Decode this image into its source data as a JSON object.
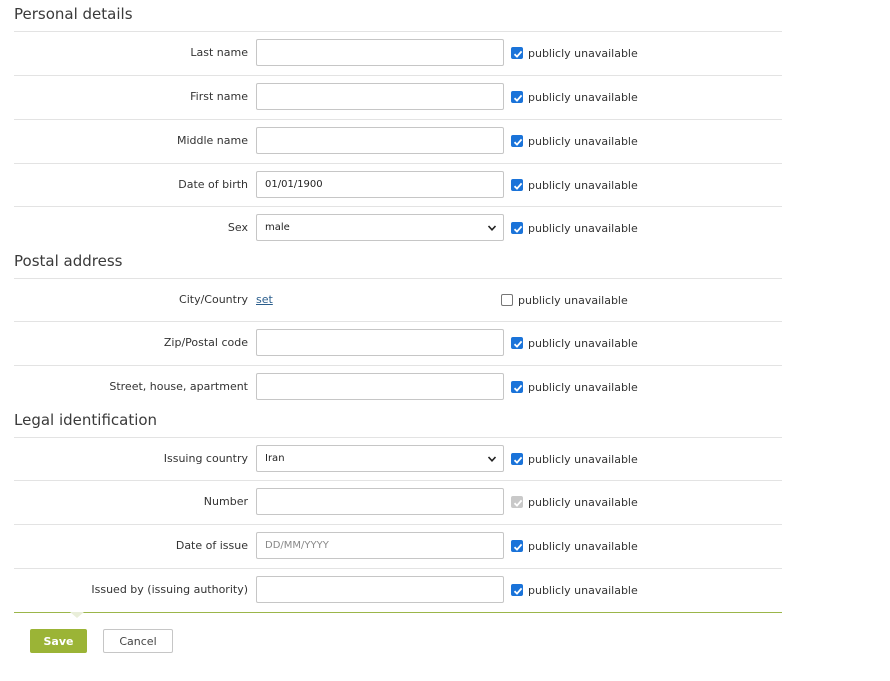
{
  "sections": {
    "personal": "Personal details",
    "postal": "Postal address",
    "legal": "Legal identification"
  },
  "checkbox_label": "publicly unavailable",
  "fields": {
    "last_name": {
      "label": "Last name",
      "value": ""
    },
    "first_name": {
      "label": "First name",
      "value": ""
    },
    "middle_name": {
      "label": "Middle name",
      "value": ""
    },
    "dob": {
      "label": "Date of birth",
      "value": "01/01/1900"
    },
    "sex": {
      "label": "Sex",
      "value": "male"
    },
    "city_country": {
      "label": "City/Country",
      "link": "set"
    },
    "zip": {
      "label": "Zip/Postal code",
      "value": ""
    },
    "street": {
      "label": "Street, house, apartment",
      "value": ""
    },
    "issuing_country": {
      "label": "Issuing country",
      "value": "Iran"
    },
    "number": {
      "label": "Number",
      "value": ""
    },
    "date_of_issue": {
      "label": "Date of issue",
      "placeholder": "DD/MM/YYYY"
    },
    "issued_by": {
      "label": "Issued by (issuing authority)",
      "value": ""
    }
  },
  "buttons": {
    "save": "Save",
    "cancel": "Cancel"
  },
  "colors": {
    "accent_green": "#9bb436",
    "checkbox_blue": "#1a73d9",
    "link_blue": "#2a5d8c"
  }
}
